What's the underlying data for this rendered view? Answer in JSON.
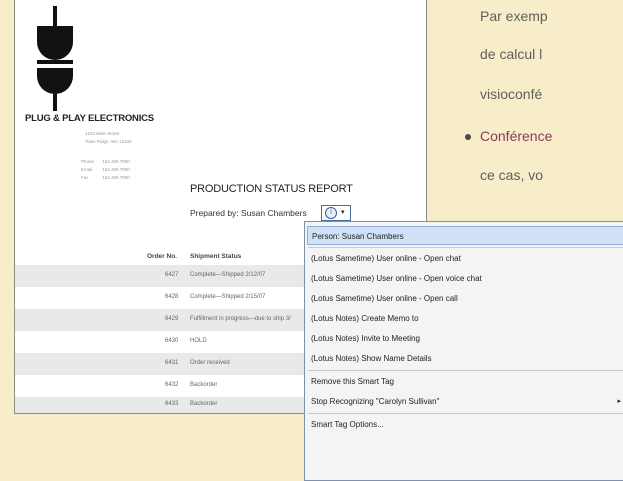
{
  "document": {
    "company_name": "PLUG & PLAY ELECTRONICS",
    "address_line1": "1234 Main Street",
    "address_line2": "Town Ridge, WA 12345",
    "contact": [
      {
        "label": "Phone",
        "value": "123.456.7890"
      },
      {
        "label": "Email",
        "value": "123.456.7890"
      },
      {
        "label": "Fax",
        "value": "123.456.7890"
      }
    ],
    "report_title": "PRODUCTION STATUS REPORT",
    "prepared_by": "Prepared by: Susan Chambers",
    "columns": {
      "order": "Order No.",
      "status": "Shipment Status"
    },
    "rows": [
      {
        "order": "6427",
        "status": "Complete—Shipped 2/12/07"
      },
      {
        "order": "6428",
        "status": "Complete—Shipped 2/15/07"
      },
      {
        "order": "6429",
        "status": "Fulfillment in progress—due to ship 3/"
      },
      {
        "order": "6430",
        "status": "HOLD"
      },
      {
        "order": "6431",
        "status": "Order received"
      },
      {
        "order": "6432",
        "status": "Backorder"
      },
      {
        "order": "6433",
        "status": "Backorder"
      }
    ]
  },
  "smart_tag": {
    "icon": "smart-tag-info-icon",
    "arrow": "▾",
    "menu": [
      {
        "label": "Person: Susan Chambers"
      },
      {
        "label": "(Lotus Sametime) User online - Open chat"
      },
      {
        "label": "(Lotus Sametime) User online - Open voice chat"
      },
      {
        "label": "(Lotus Sametime) User online - Open call"
      },
      {
        "label": "(Lotus Notes) Create Memo to"
      },
      {
        "label": "(Lotus Notes) Invite to Meeting"
      },
      {
        "label": "(Lotus Notes) Show Name Details"
      },
      {
        "label": "Remove this Smart Tag"
      },
      {
        "label": "Stop Recognizing \"Carolyn Sullivan\""
      },
      {
        "label": "Smart Tag Options..."
      }
    ],
    "submenu_arrow": "▸"
  },
  "french_text": {
    "line1": "Par exemp",
    "line2": "de calcul l",
    "line3": "visioconfé",
    "bullet_label": "Conférence",
    "line5": "ce cas, vo"
  },
  "colors": {
    "page_background": "#f7edc9",
    "menu_highlight": "#cfe0f7",
    "bullet_accent": "#8b3a5a"
  }
}
